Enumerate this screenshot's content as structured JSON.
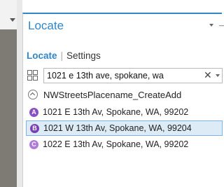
{
  "pane": {
    "title": "Locate",
    "tabs": [
      {
        "label": "Locate",
        "active": true
      },
      {
        "label": "Settings",
        "active": false
      }
    ]
  },
  "search": {
    "value": "1021 e 13th ave, spokane, wa",
    "clear_symbol": "✕"
  },
  "results_group": {
    "label": "NWStreetsPlacename_CreateAdd",
    "items": [
      {
        "badge": "A",
        "text": "1021 E 13th Av, Spokane, WA, 99202",
        "badge_color": "#8a4ec3",
        "selected": false
      },
      {
        "badge": "B",
        "text": "1021 W 13th Av, Spokane, WA, 99204",
        "badge_color": "#7a3fb5",
        "selected": true
      },
      {
        "badge": "C",
        "text": "1022 E 13th Av, Spokane, WA, 99202",
        "badge_color": "#b07ad8",
        "selected": false
      }
    ]
  },
  "colors": {
    "accent": "#2f86c8",
    "selected_bg": "#dcebf6"
  }
}
